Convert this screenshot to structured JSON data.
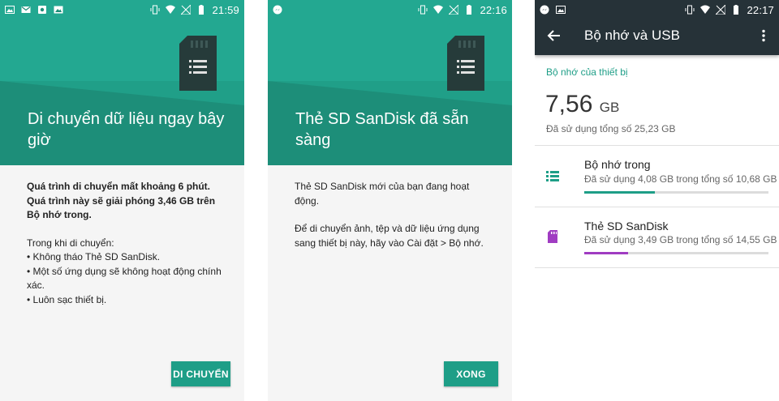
{
  "colors": {
    "accent": "#1e9e87",
    "appbar": "#263238",
    "internal_bar": "#1e9e87",
    "sd_bar": "#a03cc2"
  },
  "screen1": {
    "status_time": "21:59",
    "title": "Di chuyển dữ liệu ngay bây giờ",
    "bold_text": "Quá trình di chuyển mất khoảng 6 phút. Quá trình này sẽ giải phóng 3,46 GB trên Bộ nhớ trong.",
    "intro": "Trong khi di chuyển:",
    "bullets": [
      "• Không tháo Thẻ SD SanDisk.",
      "• Một số ứng dụng sẽ không hoạt động chính xác.",
      "• Luôn sạc thiết bị."
    ],
    "button": "DI CHUYỂN"
  },
  "screen2": {
    "status_time": "22:16",
    "title": "Thẻ SD SanDisk đã sẵn sàng",
    "para1": "Thẻ SD SanDisk mới của bạn đang hoạt động.",
    "para2": "Để di chuyển ảnh, tệp và dữ liệu ứng dụng sang thiết bị này, hãy vào Cài đặt > Bộ nhớ.",
    "button": "XONG"
  },
  "screen3": {
    "status_time": "22:17",
    "title": "Bộ nhớ và USB",
    "section": "Bộ nhớ của thiết bị",
    "total_value": "7,56",
    "total_unit": "GB",
    "total_sub": "Đã sử dụng tổng số 25,23 GB",
    "items": [
      {
        "title": "Bộ nhớ trong",
        "subtitle": "Đã sử dụng 4,08 GB trong tổng số 10,68 GB",
        "fraction": 0.382,
        "icon": "storage-list-icon"
      },
      {
        "title": "Thẻ SD SanDisk",
        "subtitle": "Đã sử dụng 3,49 GB trong tổng số 14,55 GB",
        "fraction": 0.24,
        "icon": "sd-card-icon"
      }
    ]
  }
}
